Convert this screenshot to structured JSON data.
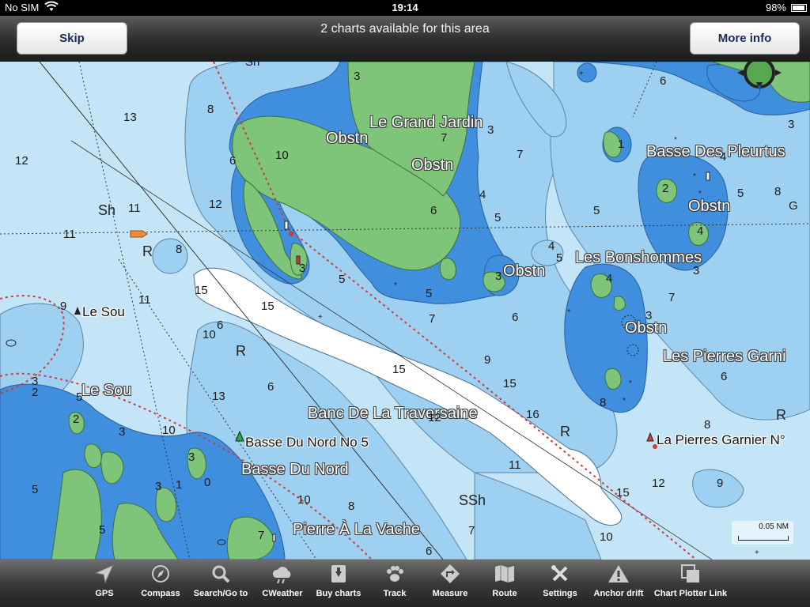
{
  "status": {
    "carrier": "No SIM",
    "time": "19:14",
    "battery": "98%"
  },
  "topbar": {
    "banner": "2 charts available for this area",
    "skip_label": "Skip",
    "more_info_label": "More info"
  },
  "map": {
    "place_names": {
      "le_grand_jardin": "Le Grand Jardin",
      "basse_des_pleurtus": "Basse Des Pleurtus",
      "les_bonshommes": "Les Bonshommes",
      "les_pierres_garnier": "Les Pierres Garni",
      "le_sou_big": "Le Sou",
      "banc_de_la_traversaine": "Banc De La Traversaine",
      "basse_du_nord": "Basse Du Nord",
      "pierre_a_la_vache": "Pierre À La Vache"
    },
    "obstn_label": "Obstn",
    "buoys": {
      "le_sou": "Le Sou",
      "basse_du_nord_no5": "Basse Du Nord No 5",
      "la_pierres_garnier": "La Pierres Garnier N°"
    },
    "scale_label": "0.05 NM"
  },
  "toolbar": {
    "gps": "GPS",
    "compass": "Compass",
    "search": "Search/Go to",
    "cweather": "CWeather",
    "buy_charts": "Buy charts",
    "track": "Track",
    "measure": "Measure",
    "route": "Route",
    "settings": "Settings",
    "anchor_drift": "Anchor drift",
    "chart_plotter_link": "Chart Plotter Link"
  },
  "colors": {
    "deep_water": "#c4e4f8",
    "mid_water": "#9ed0f2",
    "shallow_water": "#3f8fde",
    "land": "#7ec57a",
    "sand": "#ffffff",
    "channel": "#d23a3a"
  }
}
